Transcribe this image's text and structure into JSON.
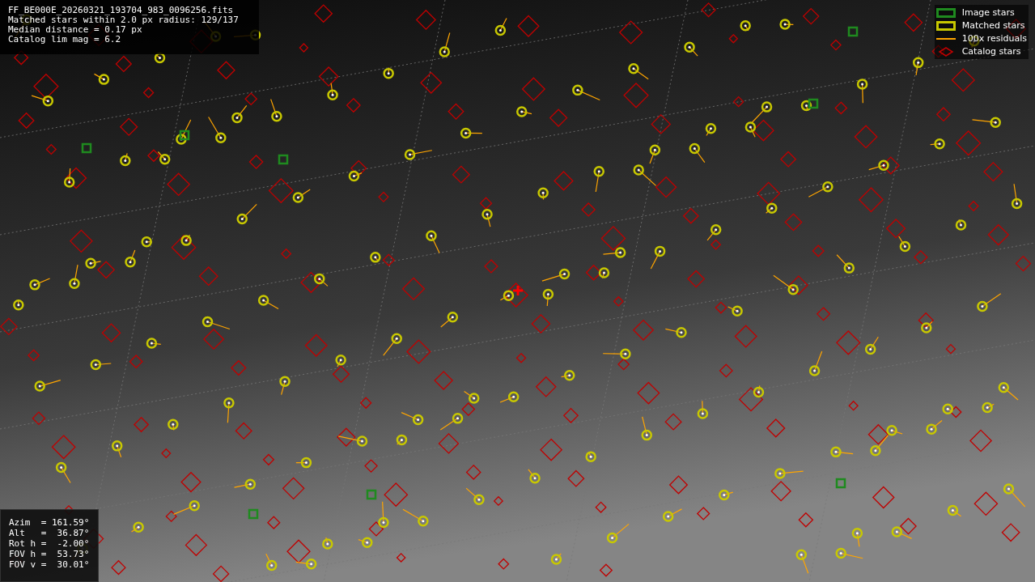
{
  "info": [
    "FF_BE000E_20260321_193704_983_0096256.fits",
    "Matched stars within 2.0 px radius: 129/137",
    "Median distance = 0.17 px",
    "Catalog lim mag = 6.2"
  ],
  "legend": [
    {
      "kind": "box",
      "label": "Image stars",
      "color": "#1f8a1f"
    },
    {
      "kind": "box",
      "label": "Matched stars",
      "color": "#c8c800"
    },
    {
      "kind": "line",
      "label": "100x residuals",
      "color": "#ffa500"
    },
    {
      "kind": "diamond",
      "label": "Catalog stars",
      "color": "#c00000"
    }
  ],
  "pointing": [
    "Azim  = 161.59°",
    "Alt   =  36.87°",
    "Rot h =  -2.00°",
    "FOV h =  53.73°",
    "FOV v =  30.01°"
  ]
}
